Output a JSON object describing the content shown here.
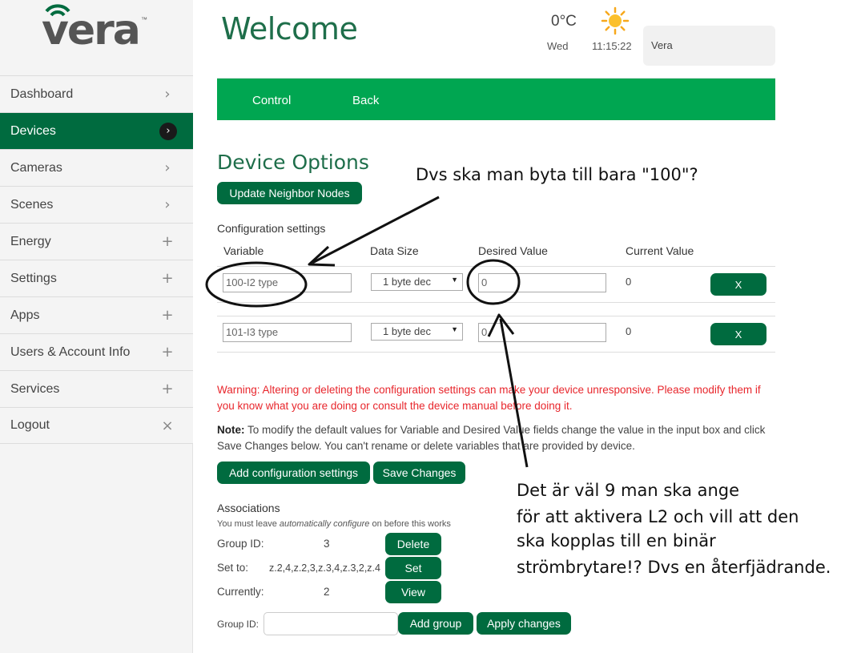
{
  "logo": {
    "text": "vera",
    "tm": "™"
  },
  "nav": [
    {
      "label": "Dashboard",
      "icon": "›"
    },
    {
      "label": "Devices",
      "icon": "›"
    },
    {
      "label": "Cameras",
      "icon": "›"
    },
    {
      "label": "Scenes",
      "icon": "›"
    },
    {
      "label": "Energy",
      "icon": "+"
    },
    {
      "label": "Settings",
      "icon": "+"
    },
    {
      "label": "Apps",
      "icon": "+"
    },
    {
      "label": "Users & Account Info",
      "icon": "+"
    },
    {
      "label": "Services",
      "icon": "+"
    },
    {
      "label": "Logout",
      "icon": "×"
    }
  ],
  "header": {
    "title": "Welcome",
    "temperature": "0°C",
    "day": "Wed",
    "time": "11:15:22",
    "user": "Vera"
  },
  "tabs": {
    "control": "Control",
    "back": "Back"
  },
  "device_options": {
    "title": "Device Options",
    "update_neighbor": "Update Neighbor Nodes",
    "config_title": "Configuration settings",
    "columns": {
      "variable": "Variable",
      "data_size": "Data Size",
      "desired": "Desired Value",
      "current": "Current Value"
    },
    "rows": [
      {
        "variable": "100-I2 type",
        "size": "1 byte dec",
        "desired": "0",
        "current": "0",
        "remove": "X"
      },
      {
        "variable": "101-I3 type",
        "size": "1 byte dec",
        "desired": "0",
        "current": "0",
        "remove": "X"
      }
    ],
    "warning": "Warning: Altering or deleting the configuration settings can make your device unresponsive. Please modify them if you know what you are doing or consult the device manual before doing it.",
    "note_label": "Note:",
    "note_text": " To modify the default values for Variable and Desired Value fields change the value in the input box and click Save Changes below. You can't rename or delete variables that are provided by device.",
    "add_config": "Add configuration settings",
    "save_changes": "Save Changes"
  },
  "associations": {
    "title": "Associations",
    "sub_pre": "You must leave ",
    "sub_em": "automatically configure",
    "sub_post": " on before this works",
    "group_label": "Group ID:",
    "group_value": "3",
    "delete": "Delete",
    "set_label": "Set to:",
    "set_value": "z.2,4,z.2,3,z.3,4,z.3,2,z.4",
    "set": "Set",
    "current_label": "Currently:",
    "current_value": "2",
    "view": "View",
    "group_id_label": "Group ID:",
    "group_id_value": "",
    "add_group": "Add group",
    "apply": "Apply changes"
  },
  "annotations": {
    "question": "Dvs ska man byta till bara \"100\"?",
    "line1": "Det är väl 9 man ska ange",
    "line2": "för att aktivera L2 och vill att den",
    "line3": "ska kopplas till en binär",
    "line4": "strömbrytare!? Dvs en återfjädrande."
  },
  "colors": {
    "brand_green": "#006b3f",
    "bar_green": "#00a651",
    "warning_red": "#e8262c",
    "title_green": "#1e6e4a"
  }
}
